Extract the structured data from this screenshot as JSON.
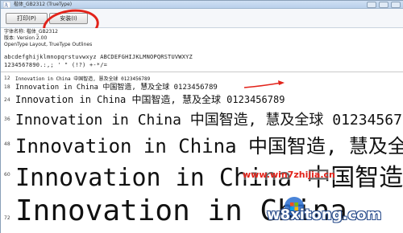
{
  "window": {
    "title": "楷体_GB2312 (TrueType)"
  },
  "toolbar": {
    "print_label": "打印(P)",
    "install_label": "安装(I)"
  },
  "info": {
    "font_name": "字体名称: 楷体_GB2312",
    "version": "版本: Version 2.00",
    "type": "OpenType Layout, TrueType Outlines",
    "sample_lower": "abcdefghijklmnopqrstuvwxyz ABCDEFGHIJKLMNOPQRSTUVWXYZ",
    "sample_digits": "1234567890.:,; ' \" (!?) +-*/="
  },
  "preview": {
    "rows": [
      {
        "size": "12",
        "text": "Innovation in China 中国智造, 慧及全球 0123456789"
      },
      {
        "size": "18",
        "text": "Innovation in China 中国智造, 慧及全球 0123456789"
      },
      {
        "size": "24",
        "text": "Innovation in China 中国智造, 慧及全球 0123456789"
      },
      {
        "size": "36",
        "text": "Innovation in China 中国智造, 慧及全球 0123456789"
      },
      {
        "size": "48",
        "text": "Innovation in China 中国智造, 慧及全球"
      },
      {
        "size": "60",
        "text": "Innovation in China 中国智造"
      },
      {
        "size": "72",
        "text": "Innovation in China"
      }
    ]
  },
  "watermark": {
    "top": "www.win7zhijia.cn",
    "bottom": "w8xitong.com"
  },
  "colors": {
    "annotation_red": "#e2231a",
    "titlebar": "#cfe0f4"
  },
  "icons": {
    "app": "font-icon",
    "arrow": "red-arrow"
  }
}
